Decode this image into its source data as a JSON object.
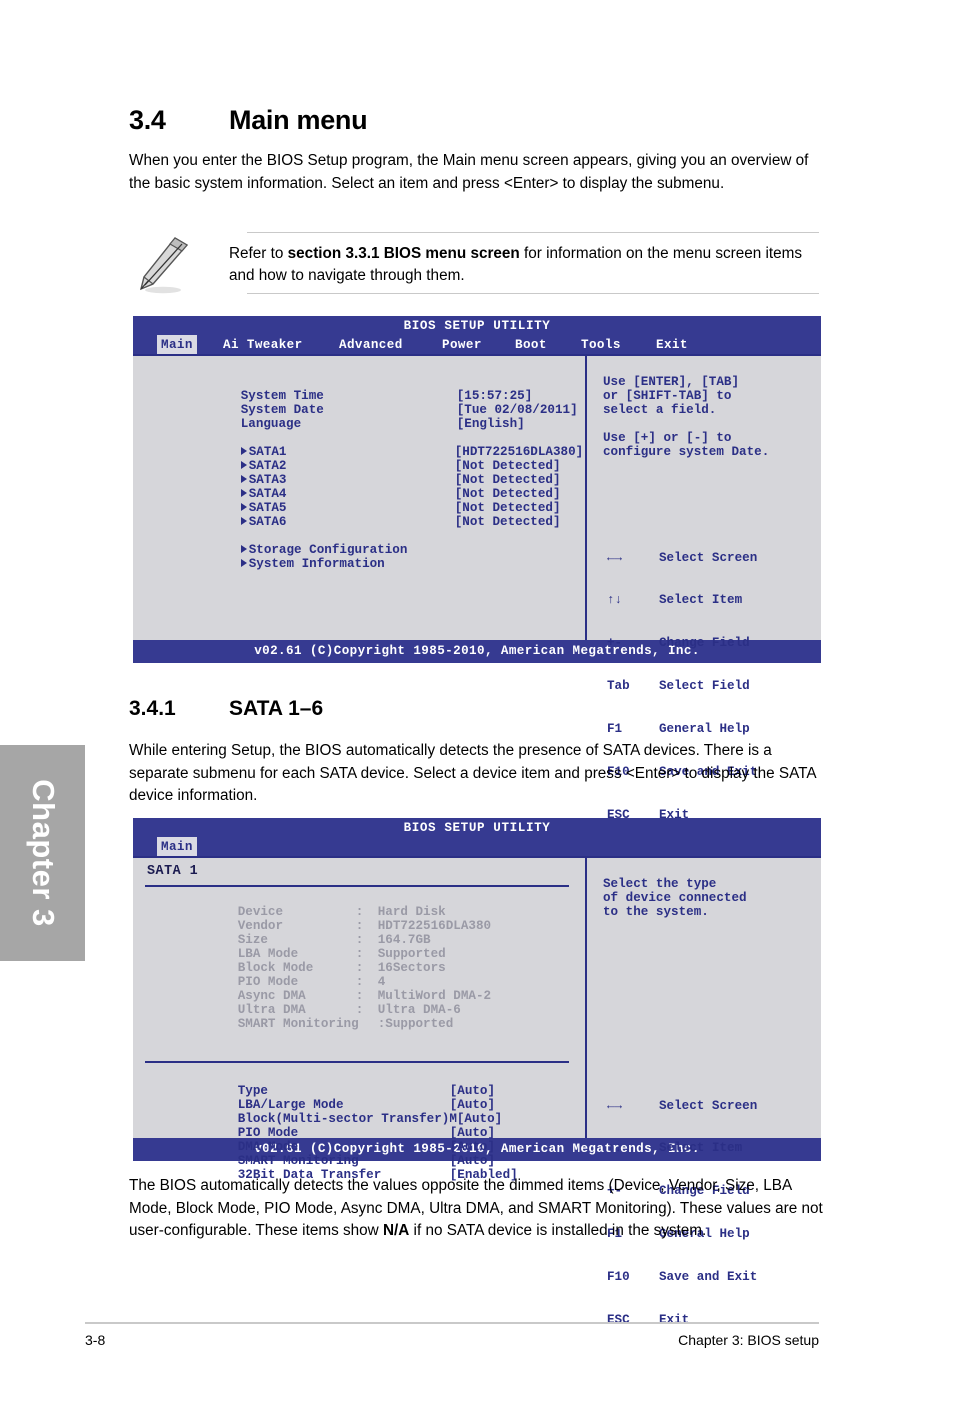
{
  "chapter_tab": {
    "label": "Chapter 3"
  },
  "section": {
    "number": "3.4",
    "title": "Main menu",
    "intro": "When you enter the BIOS Setup program, the Main menu screen appears, giving you an overview of the basic system information. Select an item and press <Enter> to display the submenu."
  },
  "note": {
    "icon": "pencil-note-icon",
    "text_before": "Refer to ",
    "text_bold": "section 3.3.1 BIOS menu screen",
    "text_after": " for information on the menu screen items and how to navigate through them."
  },
  "bios_main": {
    "title": "BIOS SETUP UTILITY",
    "menu": [
      {
        "label": "Main",
        "active": true
      },
      {
        "label": "Ai Tweaker",
        "active": false
      },
      {
        "label": "Advanced",
        "active": false
      },
      {
        "label": "Power",
        "active": false
      },
      {
        "label": "Boot",
        "active": false
      },
      {
        "label": "Tools",
        "active": false
      },
      {
        "label": "Exit",
        "active": false
      }
    ],
    "settings": [
      {
        "label": "System Time",
        "value": "[15:57:25]",
        "submenu": false
      },
      {
        "label": "System Date",
        "value": "[Tue 02/08/2011]",
        "submenu": false
      },
      {
        "label": "Language",
        "value": "[English]",
        "submenu": false
      }
    ],
    "devices": [
      {
        "label": "SATA1",
        "value": "[HDT722516DLA380]",
        "submenu": true
      },
      {
        "label": "SATA2",
        "value": "[Not Detected]",
        "submenu": true
      },
      {
        "label": "SATA3",
        "value": "[Not Detected]",
        "submenu": true
      },
      {
        "label": "SATA4",
        "value": "[Not Detected]",
        "submenu": true
      },
      {
        "label": "SATA5",
        "value": "[Not Detected]",
        "submenu": true
      },
      {
        "label": "SATA6",
        "value": "[Not Detected]",
        "submenu": true
      }
    ],
    "submenus": [
      {
        "label": "Storage Configuration"
      },
      {
        "label": "System Information"
      }
    ],
    "help_line1": "Use [ENTER], [TAB]",
    "help_line2": "or [SHIFT-TAB] to",
    "help_line3": "select a field.",
    "help_line4": "Use [+] or [-] to",
    "help_line5": "configure system Date.",
    "nav": [
      {
        "key": "←→",
        "action": "Select Screen"
      },
      {
        "key": "↑↓",
        "action": "Select Item"
      },
      {
        "key": "+-",
        "action": "Change Field"
      },
      {
        "key": "Tab",
        "action": "Select Field"
      },
      {
        "key": "F1",
        "action": "General Help"
      },
      {
        "key": "F10",
        "action": "Save and Exit"
      },
      {
        "key": "ESC",
        "action": "Exit"
      }
    ],
    "footer": "v02.61 (C)Copyright 1985-2010, American Megatrends, Inc."
  },
  "subsection": {
    "number": "3.4.1",
    "title": "SATA 1–6",
    "intro": "While entering Setup, the BIOS automatically detects the presence of SATA devices. There is a separate submenu for each SATA device. Select a device item and press <Enter> to display the SATA device information."
  },
  "bios_sata": {
    "title": "BIOS SETUP UTILITY",
    "menu": [
      {
        "label": "Main",
        "active": true
      }
    ],
    "panel_header": "SATA 1",
    "info": [
      {
        "label": "Device",
        "sep": ":",
        "value": "Hard Disk"
      },
      {
        "label": "Vendor",
        "sep": ":",
        "value": "HDT722516DLA380"
      },
      {
        "label": "Size",
        "sep": ":",
        "value": "164.7GB"
      },
      {
        "label": "LBA Mode",
        "sep": ":",
        "value": "Supported"
      },
      {
        "label": "Block Mode",
        "sep": ":",
        "value": "16Sectors"
      },
      {
        "label": "PIO Mode",
        "sep": ":",
        "value": "4"
      },
      {
        "label": "Async DMA",
        "sep": ":",
        "value": "MultiWord DMA-2"
      },
      {
        "label": "Ultra DMA",
        "sep": ":",
        "value": "Ultra DMA-6"
      },
      {
        "label": "SMART Monitoring",
        "sep": ":",
        "value": "Supported"
      }
    ],
    "settings": [
      {
        "label": "Type",
        "value": "[Auto]"
      },
      {
        "label": "LBA/Large Mode",
        "value": "[Auto]"
      },
      {
        "label": "Block(Multi-sector Transfer)M",
        "value": "[Auto]"
      },
      {
        "label": "PIO Mode",
        "value": "[Auto]"
      },
      {
        "label": "DMA Mode",
        "value": "[Auto]"
      },
      {
        "label": "SMART Monitoring",
        "value": "[Auto]"
      },
      {
        "label": "32Bit Data Transfer",
        "value": "[Enabled]"
      }
    ],
    "help_line1": "Select the type",
    "help_line2": "of device connected",
    "help_line3": "to the system.",
    "nav": [
      {
        "key": "←→",
        "action": "Select Screen"
      },
      {
        "key": "↑↓",
        "action": "Select Item"
      },
      {
        "key": "+-",
        "action": "Change Field"
      },
      {
        "key": "F1",
        "action": "General Help"
      },
      {
        "key": "F10",
        "action": "Save and Exit"
      },
      {
        "key": "ESC",
        "action": "Exit"
      }
    ],
    "footer": "v02.61 (C)Copyright 1985-2010, American Megatrends, Inc."
  },
  "closing": {
    "part1": "The BIOS automatically detects the values opposite the dimmed items (Device, Vendor, Size, LBA Mode, Block Mode, PIO Mode, Async DMA, Ultra DMA, and SMART Monitoring). These values are not user-configurable. These items show ",
    "bold": "N/A",
    "part2": " if no SATA device is installed in the system."
  },
  "page_footer": {
    "page_number": "3-8",
    "chapter_label": "Chapter 3: BIOS setup"
  },
  "colors": {
    "bios_blue": "#363a91",
    "bios_text_blue": "#2b2f86",
    "bios_body_gray": "#d6d6da",
    "bios_dim_gray": "#9a9aa6",
    "chapter_tab_gray": "#a6a6a6"
  }
}
